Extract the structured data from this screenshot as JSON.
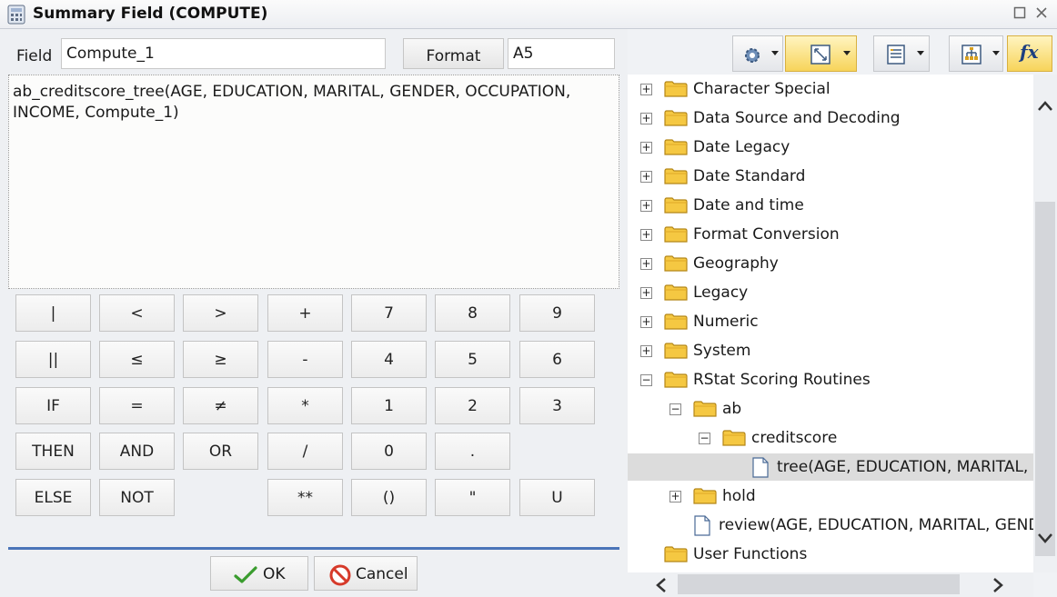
{
  "window": {
    "title": "Summary Field (COMPUTE)",
    "icons": {
      "app": "calculator-icon",
      "restore": "restore-icon",
      "close": "close-icon"
    }
  },
  "field": {
    "label": "Field",
    "value": "Compute_1"
  },
  "format": {
    "button_label": "Format",
    "value": "A5"
  },
  "expression": "ab_creditscore_tree(AGE, EDUCATION, MARITAL, GENDER, OCCUPATION,\nINCOME, Compute_1)",
  "keypad": {
    "rows": [
      [
        "|",
        "<",
        ">",
        "+",
        "7",
        "8",
        "9"
      ],
      [
        "||",
        "≤",
        "≥",
        "-",
        "4",
        "5",
        "6"
      ],
      [
        "IF",
        "=",
        "≠",
        "*",
        "1",
        "2",
        "3"
      ],
      [
        "THEN",
        "AND",
        "OR",
        "/",
        "0",
        ".",
        ""
      ],
      [
        "ELSE",
        "NOT",
        "",
        "**",
        "()",
        "\"",
        "U"
      ]
    ]
  },
  "buttons": {
    "ok": "OK",
    "cancel": "Cancel"
  },
  "toolbar": {
    "items": [
      "settings-icon",
      "fit-icon",
      "list-view-icon",
      "tree-view-icon",
      "function-icon"
    ],
    "function_label": "fx"
  },
  "tree": {
    "items": [
      {
        "label": "Character Special",
        "type": "folder",
        "expander": "+"
      },
      {
        "label": "Data Source and Decoding",
        "type": "folder",
        "expander": "+"
      },
      {
        "label": "Date Legacy",
        "type": "folder",
        "expander": "+"
      },
      {
        "label": "Date Standard",
        "type": "folder",
        "expander": "+"
      },
      {
        "label": "Date and time",
        "type": "folder",
        "expander": "+"
      },
      {
        "label": "Format Conversion",
        "type": "folder",
        "expander": "+"
      },
      {
        "label": "Geography",
        "type": "folder",
        "expander": "+"
      },
      {
        "label": "Legacy",
        "type": "folder",
        "expander": "+"
      },
      {
        "label": "Numeric",
        "type": "folder",
        "expander": "+"
      },
      {
        "label": "System",
        "type": "folder",
        "expander": "+"
      },
      {
        "label": "RStat Scoring Routines",
        "type": "folder",
        "expander": "−"
      },
      {
        "label": "ab",
        "type": "folder",
        "expander": "−"
      },
      {
        "label": "creditscore",
        "type": "folder",
        "expander": "−"
      },
      {
        "label": "tree(AGE, EDUCATION, MARITAL, GENDER, OCCUPATION, INCOME)",
        "type": "file",
        "selected": true
      },
      {
        "label": "hold",
        "type": "folder",
        "expander": "+"
      },
      {
        "label": "review(AGE, EDUCATION, MARITAL, GENDER, OCCUPATION, INCOME)",
        "type": "file"
      },
      {
        "label": "User Functions",
        "type": "folder"
      }
    ]
  },
  "colors": {
    "accent": "#4a74b8",
    "folder": "#f5c842",
    "selection": "#dcdcdc",
    "active_tool": "#f7d45a"
  }
}
